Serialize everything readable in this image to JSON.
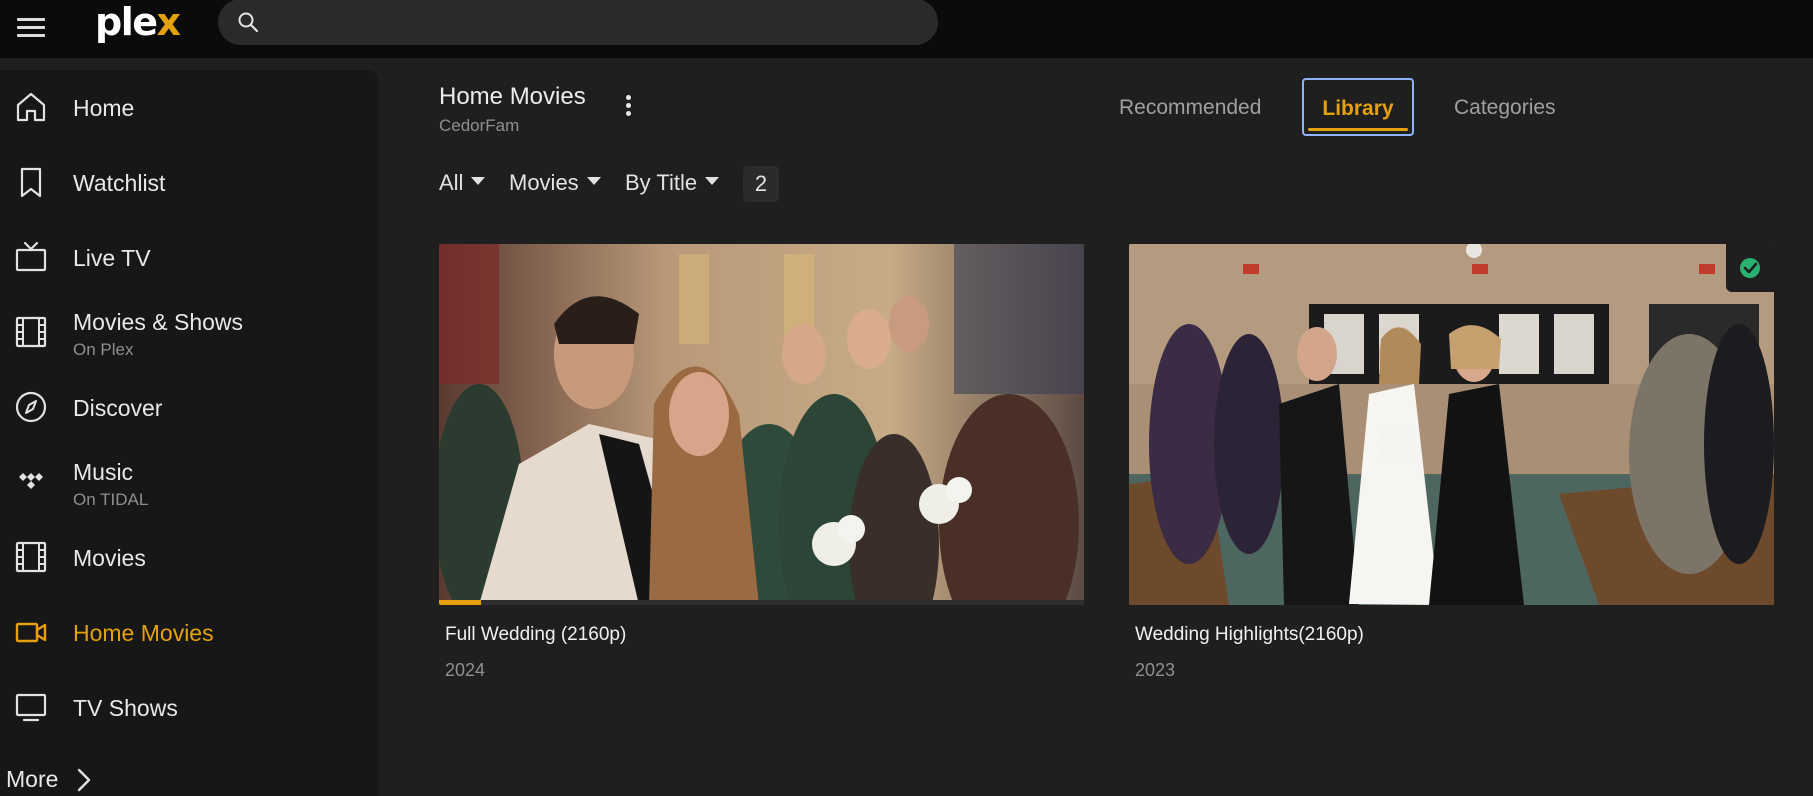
{
  "app": {
    "logo_text": "plex",
    "brand_color": "#e5a00d"
  },
  "search": {
    "placeholder": "",
    "value": ""
  },
  "sidebar": {
    "items": [
      {
        "label": "Home",
        "sub": "",
        "icon": "home-icon",
        "active": false
      },
      {
        "label": "Watchlist",
        "sub": "",
        "icon": "bookmark-icon",
        "active": false
      },
      {
        "label": "Live TV",
        "sub": "",
        "icon": "tv-icon",
        "active": false
      },
      {
        "label": "Movies & Shows",
        "sub": "On Plex",
        "icon": "film-icon",
        "active": false
      },
      {
        "label": "Discover",
        "sub": "",
        "icon": "compass-icon",
        "active": false
      },
      {
        "label": "Music",
        "sub": "On TIDAL",
        "icon": "tidal-icon",
        "active": false
      },
      {
        "label": "Movies",
        "sub": "",
        "icon": "film-icon",
        "active": false
      },
      {
        "label": "Home Movies",
        "sub": "",
        "icon": "video-camera-icon",
        "active": true
      },
      {
        "label": "TV Shows",
        "sub": "",
        "icon": "monitor-icon",
        "active": false
      }
    ],
    "more_label": "More"
  },
  "library": {
    "title": "Home Movies",
    "server": "CedorFam"
  },
  "tabs": [
    {
      "label": "Recommended",
      "active": false
    },
    {
      "label": "Library",
      "active": true
    },
    {
      "label": "Categories",
      "active": false
    }
  ],
  "filters": {
    "all_label": "All",
    "type_label": "Movies",
    "sort_label": "By Title",
    "count": "2"
  },
  "items": [
    {
      "title": "Full Wedding (2160p)",
      "year": "2024",
      "progress": 0.065,
      "watched": false
    },
    {
      "title": "Wedding Highlights(2160p)",
      "year": "2023",
      "progress": 0,
      "watched": true
    }
  ],
  "colors": {
    "accent": "#e5a00d",
    "watched_badge": "#2ab06f",
    "focus_ring": "#8fb3ff"
  }
}
